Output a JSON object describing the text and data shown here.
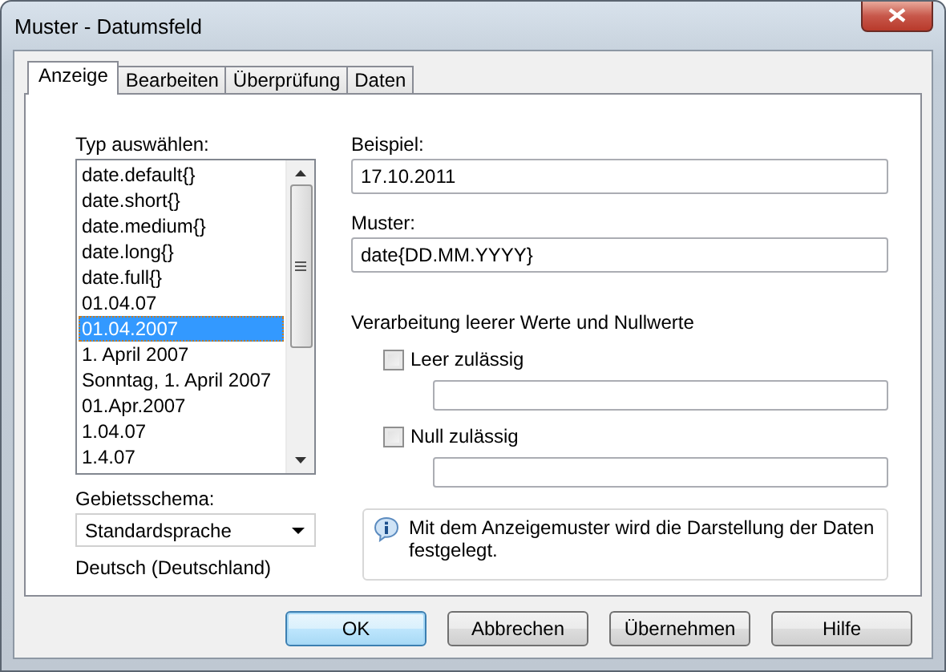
{
  "window": {
    "title": "Muster - Datumsfeld"
  },
  "tabs": [
    {
      "label": "Anzeige",
      "selected": true
    },
    {
      "label": "Bearbeiten",
      "selected": false
    },
    {
      "label": "Überprüfung",
      "selected": false
    },
    {
      "label": "Daten",
      "selected": false
    }
  ],
  "type_list": {
    "label": "Typ auswählen:",
    "items": [
      {
        "text": "date.default{}",
        "selected": false
      },
      {
        "text": "date.short{}",
        "selected": false
      },
      {
        "text": "date.medium{}",
        "selected": false
      },
      {
        "text": "date.long{}",
        "selected": false
      },
      {
        "text": "date.full{}",
        "selected": false
      },
      {
        "text": "01.04.07",
        "selected": false
      },
      {
        "text": "01.04.2007",
        "selected": true
      },
      {
        "text": "1. April 2007",
        "selected": false
      },
      {
        "text": "Sonntag, 1. April 2007",
        "selected": false
      },
      {
        "text": "01.Apr.2007",
        "selected": false
      },
      {
        "text": "1.04.07",
        "selected": false
      },
      {
        "text": "1.4.07",
        "selected": false
      }
    ]
  },
  "locale": {
    "label": "Gebietsschema:",
    "value": "Standardsprache",
    "description": "Deutsch (Deutschland)"
  },
  "example": {
    "label": "Beispiel:",
    "value": "17.10.2011"
  },
  "pattern": {
    "label": "Muster:",
    "value": "date{DD.MM.YYYY}"
  },
  "null_handling": {
    "heading": "Verarbeitung leerer Werte und Nullwerte",
    "options": [
      {
        "label": "Leer zulässig",
        "checked": false
      },
      {
        "label": "Null zulässig",
        "checked": false
      }
    ]
  },
  "info": "Mit dem Anzeigemuster wird die Darstellung der Daten festgelegt.",
  "buttons": [
    {
      "label": "OK",
      "default": true
    },
    {
      "label": "Abbrechen",
      "default": false
    },
    {
      "label": "Übernehmen",
      "default": false
    },
    {
      "label": "Hilfe",
      "default": false
    }
  ]
}
